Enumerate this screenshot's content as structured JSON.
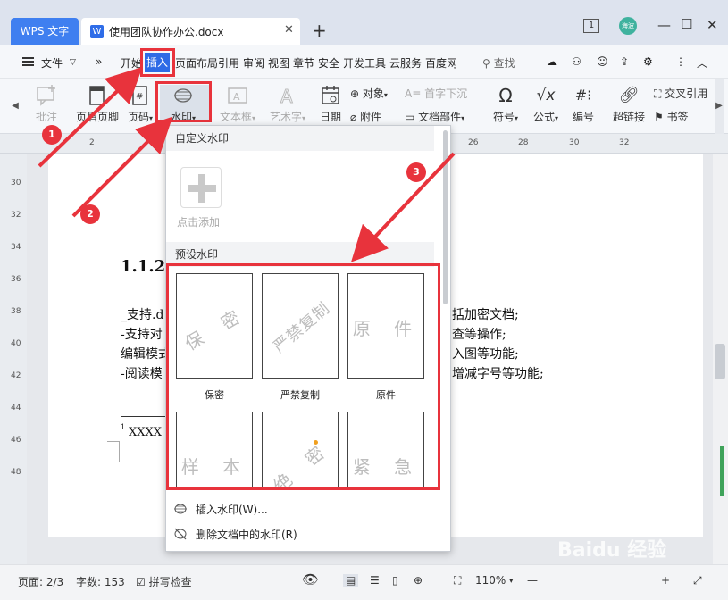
{
  "titlebar": {
    "app_tab": "WPS 文字",
    "doc_tab": "使用团队协作办公.docx",
    "doc_icon": "W",
    "close": "✕",
    "new_tab": "+",
    "window_count": "1",
    "avatar_text": "海波"
  },
  "menubar": {
    "file": "文件",
    "expand": "»",
    "items": [
      "开始",
      "插入",
      "页面布局",
      "引用",
      "审阅",
      "视图",
      "章节",
      "安全",
      "开发工具",
      "云服务",
      "百度网"
    ],
    "search": "查找"
  },
  "ribbon": {
    "comment": "批注",
    "header_footer": "页眉页脚",
    "page_number": "页码",
    "watermark": "水印",
    "textbox": "文本框",
    "wordart": "艺术字",
    "date": "日期",
    "object": "对象",
    "attachment": "附件",
    "dropcap": "首字下沉",
    "doc_parts": "文档部件",
    "symbol": "符号",
    "formula": "公式",
    "numbering": "编号",
    "hyperlink": "超链接",
    "crossref": "交叉引用",
    "bookmark": "书签"
  },
  "ruler_ticks": [
    "2",
    "26",
    "28",
    "30",
    "32"
  ],
  "vruler_ticks": [
    "30",
    "32",
    "34",
    "36",
    "38",
    "40",
    "42",
    "44",
    "46",
    "48"
  ],
  "doc": {
    "heading": "1.1.2.",
    "lines_left": [
      "_支持.d",
      "-支持对",
      "编辑模式",
      "-阅读模"
    ],
    "lines_right": [
      "括加密文档;",
      "查等操作;",
      "入图等功能;",
      "增减字号等功能;"
    ],
    "footnote": "XXXX",
    "footnote_mark": "1"
  },
  "dropdown": {
    "custom_header": "自定义水印",
    "add_label": "点击添加",
    "preset_header": "预设水印",
    "presets": [
      {
        "text": "保 密",
        "name": "保密",
        "rotate": -30
      },
      {
        "text": "严禁复制",
        "name": "严禁复制",
        "rotate": -40
      },
      {
        "text": "原 件",
        "name": "原件",
        "rotate": 0
      },
      {
        "text": "样 本",
        "name": "",
        "rotate": 0
      },
      {
        "text": "绝 密",
        "name": "",
        "rotate": -40
      },
      {
        "text": "紧 急",
        "name": "",
        "rotate": 0
      }
    ],
    "insert": "插入水印(W)...",
    "delete": "删除文档中的水印(R)"
  },
  "statusbar": {
    "page": "页面: 2/3",
    "words": "字数: 153",
    "spellcheck": "拼写检查",
    "zoom": "110%",
    "zoom_out": "—",
    "zoom_in": "+"
  },
  "annotations": {
    "badge1": "1",
    "badge2": "2",
    "badge3": "3",
    "color": "#e8333c"
  },
  "watermark_logo": "Baidu 经验"
}
